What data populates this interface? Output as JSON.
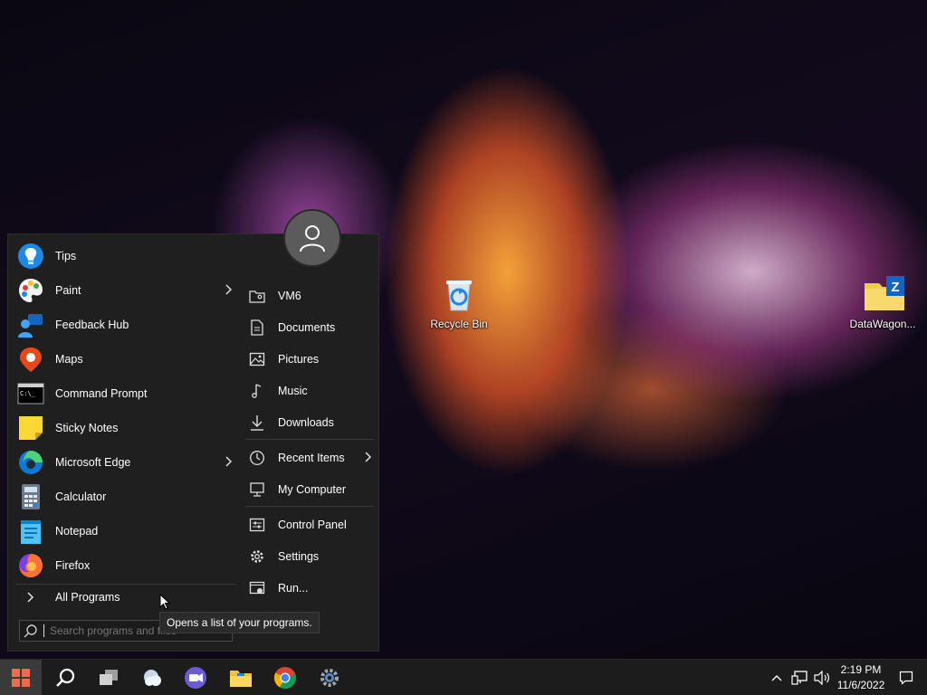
{
  "desktop": {
    "icons": [
      {
        "label": "Recycle Bin"
      },
      {
        "label": "DataWagon..."
      }
    ]
  },
  "start_menu": {
    "programs": [
      {
        "label": "Tips",
        "icon": "lightbulb-icon",
        "submenu": false
      },
      {
        "label": "Paint",
        "icon": "palette-icon",
        "submenu": true
      },
      {
        "label": "Feedback Hub",
        "icon": "feedback-icon",
        "submenu": false
      },
      {
        "label": "Maps",
        "icon": "map-pin-icon",
        "submenu": false
      },
      {
        "label": "Command Prompt",
        "icon": "terminal-icon",
        "submenu": false
      },
      {
        "label": "Sticky Notes",
        "icon": "sticky-note-icon",
        "submenu": false
      },
      {
        "label": "Microsoft Edge",
        "icon": "edge-icon",
        "submenu": true
      },
      {
        "label": "Calculator",
        "icon": "calculator-icon",
        "submenu": false
      },
      {
        "label": "Notepad",
        "icon": "notepad-icon",
        "submenu": false
      },
      {
        "label": "Firefox",
        "icon": "firefox-icon",
        "submenu": false
      }
    ],
    "all_programs_label": "All Programs",
    "search_placeholder": "Search programs and files",
    "places": [
      {
        "label": "VM6",
        "icon": "user-folder-icon",
        "submenu": false
      },
      {
        "label": "Documents",
        "icon": "document-icon",
        "submenu": false
      },
      {
        "label": "Pictures",
        "icon": "picture-icon",
        "submenu": false
      },
      {
        "label": "Music",
        "icon": "music-note-icon",
        "submenu": false
      },
      {
        "label": "Downloads",
        "icon": "download-icon",
        "submenu": false
      },
      {
        "label": "Recent Items",
        "icon": "clock-icon",
        "submenu": true
      },
      {
        "label": "My Computer",
        "icon": "computer-icon",
        "submenu": false
      },
      {
        "label": "Control Panel",
        "icon": "control-panel-icon",
        "submenu": false
      },
      {
        "label": "Settings",
        "icon": "gear-icon",
        "submenu": false
      },
      {
        "label": "Run...",
        "icon": "run-icon",
        "submenu": false
      }
    ],
    "tooltip": "Opens a list of your programs."
  },
  "taskbar": {
    "apps": [
      "start-icon",
      "search-icon",
      "task-view-icon",
      "weather-icon",
      "chat-icon",
      "file-explorer-icon",
      "chrome-icon",
      "settings-icon"
    ],
    "clock_time": "2:19 PM",
    "clock_date": "11/6/2022"
  }
}
